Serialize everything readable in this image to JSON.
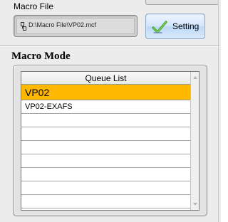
{
  "macro_file": {
    "label": "Macro File",
    "path": "D:\\Macro File\\VP02.mcf",
    "icon": "file-path-icon"
  },
  "setting_button": {
    "label": "Setting",
    "icon": "checkmark-icon"
  },
  "macro_mode": {
    "title": "Macro Mode"
  },
  "queue_list": {
    "header": "Queue List",
    "items": [
      "VP02",
      "VP02-EXAFS",
      "",
      "",
      "",
      "",
      "",
      "",
      "",
      ""
    ],
    "selected_index": 0,
    "selected_color": "#ffb800"
  }
}
